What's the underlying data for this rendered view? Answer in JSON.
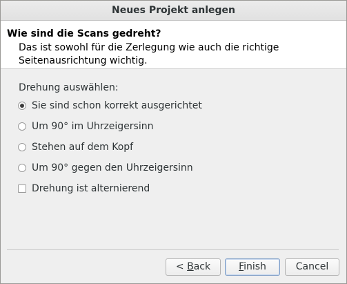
{
  "window": {
    "title": "Neues Projekt anlegen"
  },
  "header": {
    "title": "Wie sind die Scans gedreht?",
    "description": "Das ist sowohl für die Zerlegung wie auch die richtige Seitenausrichtung wichtig."
  },
  "rotation": {
    "group_label": "Drehung auswählen:",
    "options": [
      {
        "label": "Sie sind schon korrekt ausgerichtet",
        "selected": true
      },
      {
        "label": "Um 90° im Uhrzeigersinn",
        "selected": false
      },
      {
        "label": "Stehen auf dem Kopf",
        "selected": false
      },
      {
        "label": "Um 90° gegen den Uhrzeigersinn",
        "selected": false
      }
    ],
    "alternating": {
      "label": "Drehung ist alternierend",
      "checked": false
    }
  },
  "buttons": {
    "back": {
      "prefix": "< ",
      "mnemonic": "B",
      "rest": "ack"
    },
    "finish": {
      "prefix": "",
      "mnemonic": "F",
      "rest": "inish"
    },
    "cancel": {
      "label": "Cancel"
    }
  }
}
